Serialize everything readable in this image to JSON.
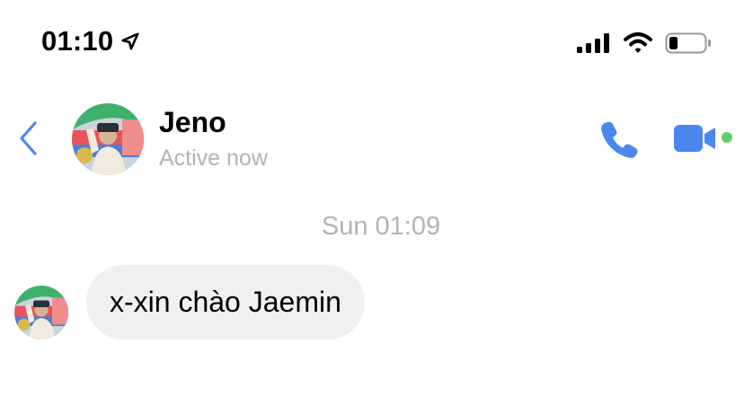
{
  "status_bar": {
    "time": "01:10",
    "icons": [
      "location-arrow-icon",
      "signal-icon",
      "wifi-icon",
      "battery-icon"
    ]
  },
  "header": {
    "back_icon": "chevron-left-icon",
    "contact_name": "Jeno",
    "contact_status": "Active now",
    "actions": [
      "phone-icon",
      "video-camera-icon"
    ],
    "online": true
  },
  "conversation": {
    "timestamp": "Sun 01:09",
    "messages": [
      {
        "direction": "incoming",
        "text": "x-xin chào Jaemin"
      }
    ]
  },
  "colors": {
    "accent": "#4c87f0",
    "online": "#5ecf6b",
    "secondary_text": "#b3b3b3",
    "bubble": "#f0f0f0"
  }
}
